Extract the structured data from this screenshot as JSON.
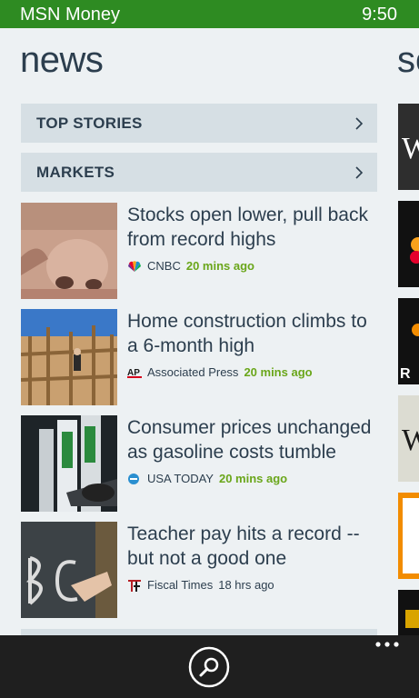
{
  "status_bar": {
    "app_name": "MSN Money",
    "time": "9:50"
  },
  "page": {
    "title": "news",
    "next_title_fragment": "so"
  },
  "sections": [
    {
      "label": "TOP STORIES",
      "icon": "chevron-right-icon"
    },
    {
      "label": "MARKETS",
      "icon": "chevron-right-icon"
    }
  ],
  "stories": [
    {
      "headline": "Stocks open lower, pull back from record highs",
      "source": "CNBC",
      "source_icon": "cnbc-peacock-icon",
      "time": "20 mins ago"
    },
    {
      "headline": "Home construction climbs to a 6-month high",
      "source": "Associated Press",
      "source_icon": "ap-logo-icon",
      "time": "20 mins ago"
    },
    {
      "headline": "Consumer prices unchanged as gasoline costs tumble",
      "source": "USA TODAY",
      "source_icon": "usa-today-dot-icon",
      "time": "20 mins ago"
    },
    {
      "headline": "Teacher pay hits a record -- but not a good one",
      "source": "Fiscal Times",
      "source_icon": "fiscal-times-icon",
      "time": "18 hrs ago"
    }
  ],
  "app_bar": {
    "search_icon": "search-icon",
    "more_icon": "more-options-icon"
  },
  "colors": {
    "status_bar": "#2e8b22",
    "accent_time": "#6aa61a",
    "text": "#2c3e4e",
    "tile": "#d6dfe4",
    "app_bar": "#1f1f1f"
  }
}
